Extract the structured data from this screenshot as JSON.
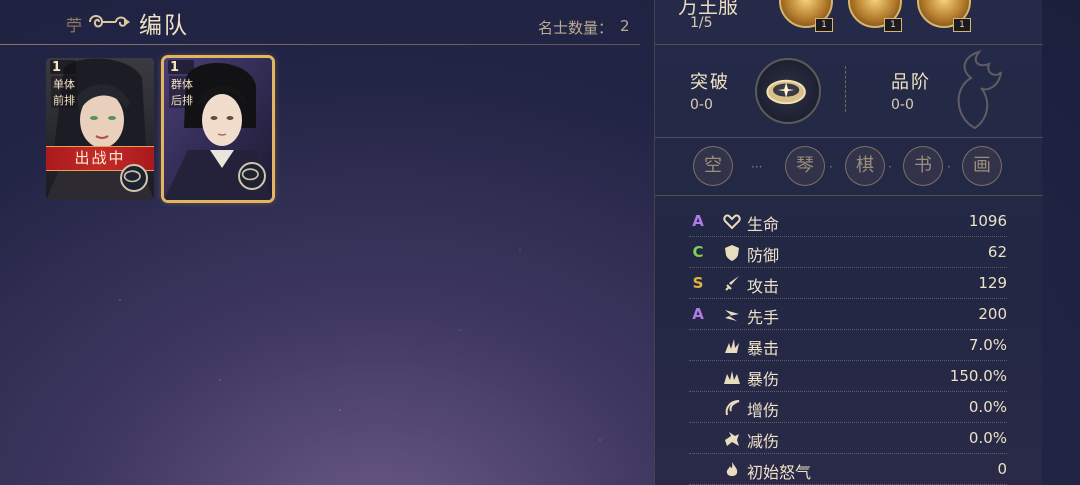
{
  "header": {
    "title": "编队",
    "count_label": "名士数量：",
    "count_value": "2",
    "deco_char": "苧"
  },
  "cards": [
    {
      "level": "1",
      "tags": [
        "单体",
        "前排"
      ],
      "status": "出战中",
      "selected": false
    },
    {
      "level": "1",
      "tags": [
        "群体",
        "后排"
      ],
      "status": "",
      "selected": true
    }
  ],
  "panel": {
    "top_title": "万王服",
    "top_progress": "1/5",
    "orbs": [
      {
        "level": "1"
      },
      {
        "level": "1"
      },
      {
        "level": "1"
      }
    ],
    "breakthrough": {
      "label": "突破",
      "value": "0-0"
    },
    "rank": {
      "label": "品阶",
      "value": "0-0"
    },
    "slots": [
      "空",
      "琴",
      "棋",
      "书",
      "画"
    ],
    "stats": [
      {
        "grade": "A",
        "grade_color": "#b07ce6",
        "icon": "heart-icon",
        "name": "生命",
        "value": "1096"
      },
      {
        "grade": "C",
        "grade_color": "#7fcf5a",
        "icon": "shield-icon",
        "name": "防御",
        "value": "62"
      },
      {
        "grade": "S",
        "grade_color": "#e3b13f",
        "icon": "sword-icon",
        "name": "攻击",
        "value": "129"
      },
      {
        "grade": "A",
        "grade_color": "#b07ce6",
        "icon": "speed-icon",
        "name": "先手",
        "value": "200"
      },
      {
        "grade": "",
        "grade_color": "",
        "icon": "crit-icon",
        "name": "暴击",
        "value": "7.0%"
      },
      {
        "grade": "",
        "grade_color": "",
        "icon": "crit-damage-icon",
        "name": "暴伤",
        "value": "150.0%"
      },
      {
        "grade": "",
        "grade_color": "",
        "icon": "damage-boost-icon",
        "name": "增伤",
        "value": "0.0%"
      },
      {
        "grade": "",
        "grade_color": "",
        "icon": "damage-reduce-icon",
        "name": "减伤",
        "value": "0.0%"
      },
      {
        "grade": "",
        "grade_color": "",
        "icon": "flame-icon",
        "name": "初始怒气",
        "value": "0"
      }
    ]
  }
}
